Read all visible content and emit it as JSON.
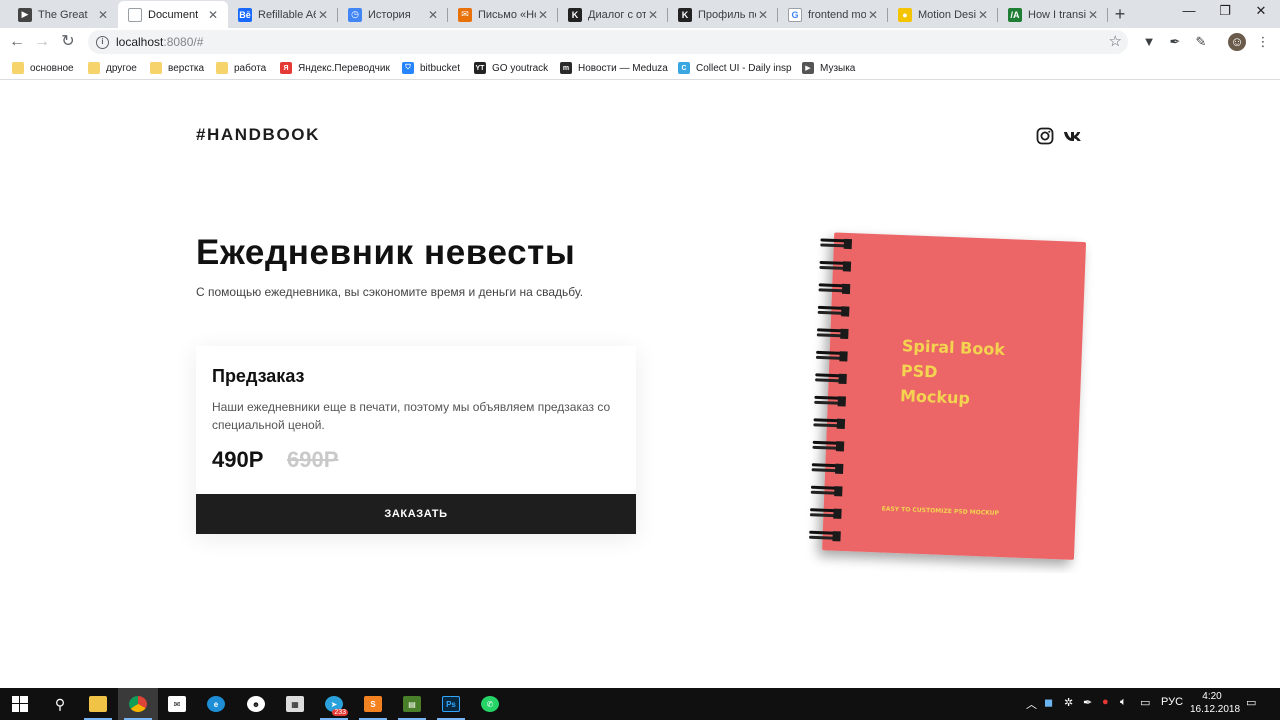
{
  "browser": {
    "tabs": [
      {
        "label": "The Great",
        "fav_color": "#444",
        "fav_text": "▶"
      },
      {
        "label": "Document",
        "fav_color": "#ffffff",
        "fav_text": "",
        "active": true
      },
      {
        "label": "Refillable A6",
        "fav_color": "#1769ff",
        "fav_text": "Bē"
      },
      {
        "label": "История",
        "fav_color": "#4285f4",
        "fav_text": "◷"
      },
      {
        "label": "Письмо «Нов",
        "fav_color": "#e8710a",
        "fav_text": "✉"
      },
      {
        "label": "Диалог с отт",
        "fav_color": "#222",
        "fav_text": "K"
      },
      {
        "label": "Профиль пол",
        "fav_color": "#222",
        "fav_text": "K"
      },
      {
        "label": "frontend moti",
        "fav_color": "#ffffff",
        "fav_text": "G"
      },
      {
        "label": "Motion Desig",
        "fav_color": "#f5c400",
        "fav_text": "●"
      },
      {
        "label": "How I transiti",
        "fav_color": "#1e7e34",
        "fav_text": "/A"
      }
    ],
    "url_host": "localhost",
    "url_path": ":8080/#",
    "bookmarks": [
      {
        "label": "основное",
        "type": "folder"
      },
      {
        "label": "другое",
        "type": "folder"
      },
      {
        "label": "верстка",
        "type": "folder"
      },
      {
        "label": "работа",
        "type": "folder"
      },
      {
        "label": "Яндекс.Переводчик",
        "type": "site",
        "color": "#e53935",
        "text": "Я"
      },
      {
        "label": "bitbucket",
        "type": "site",
        "color": "#2684ff",
        "text": "⛉"
      },
      {
        "label": "GO youtrack",
        "type": "site",
        "color": "#222",
        "text": "YT"
      },
      {
        "label": "Новости — Meduza",
        "type": "site",
        "color": "#2a2a2a",
        "text": "m"
      },
      {
        "label": "Collect UI - Daily insp",
        "type": "site",
        "color": "#3aa7e0",
        "text": "C"
      },
      {
        "label": "Музыка",
        "type": "site",
        "color": "#555",
        "text": "▶"
      }
    ]
  },
  "site": {
    "logo": "#HANDBOOK",
    "hero_title": "Ежедневник невесты",
    "hero_subtitle": "С помощью ежедневника, вы сэкономите время и деньги на свадьбу.",
    "card": {
      "title": "Предзаказ",
      "text": "Наши ежедневники еще в печати, поэтому мы объявляем предзаказ со специальной ценой.",
      "price_new": "490Р",
      "price_old": "690Р",
      "button": "ЗАКАЗАТЬ"
    },
    "notebook": {
      "cover_color": "#ec6668",
      "text_color": "#f3d34f",
      "line1": "Spiral Book",
      "line2": "PSD",
      "line3": "Mockup",
      "footer": "EASY TO CUSTOMIZE PSD MOCKUP"
    }
  },
  "taskbar": {
    "lang": "РУС",
    "time": "4:20",
    "date": "16.12.2018",
    "badge": "233"
  }
}
